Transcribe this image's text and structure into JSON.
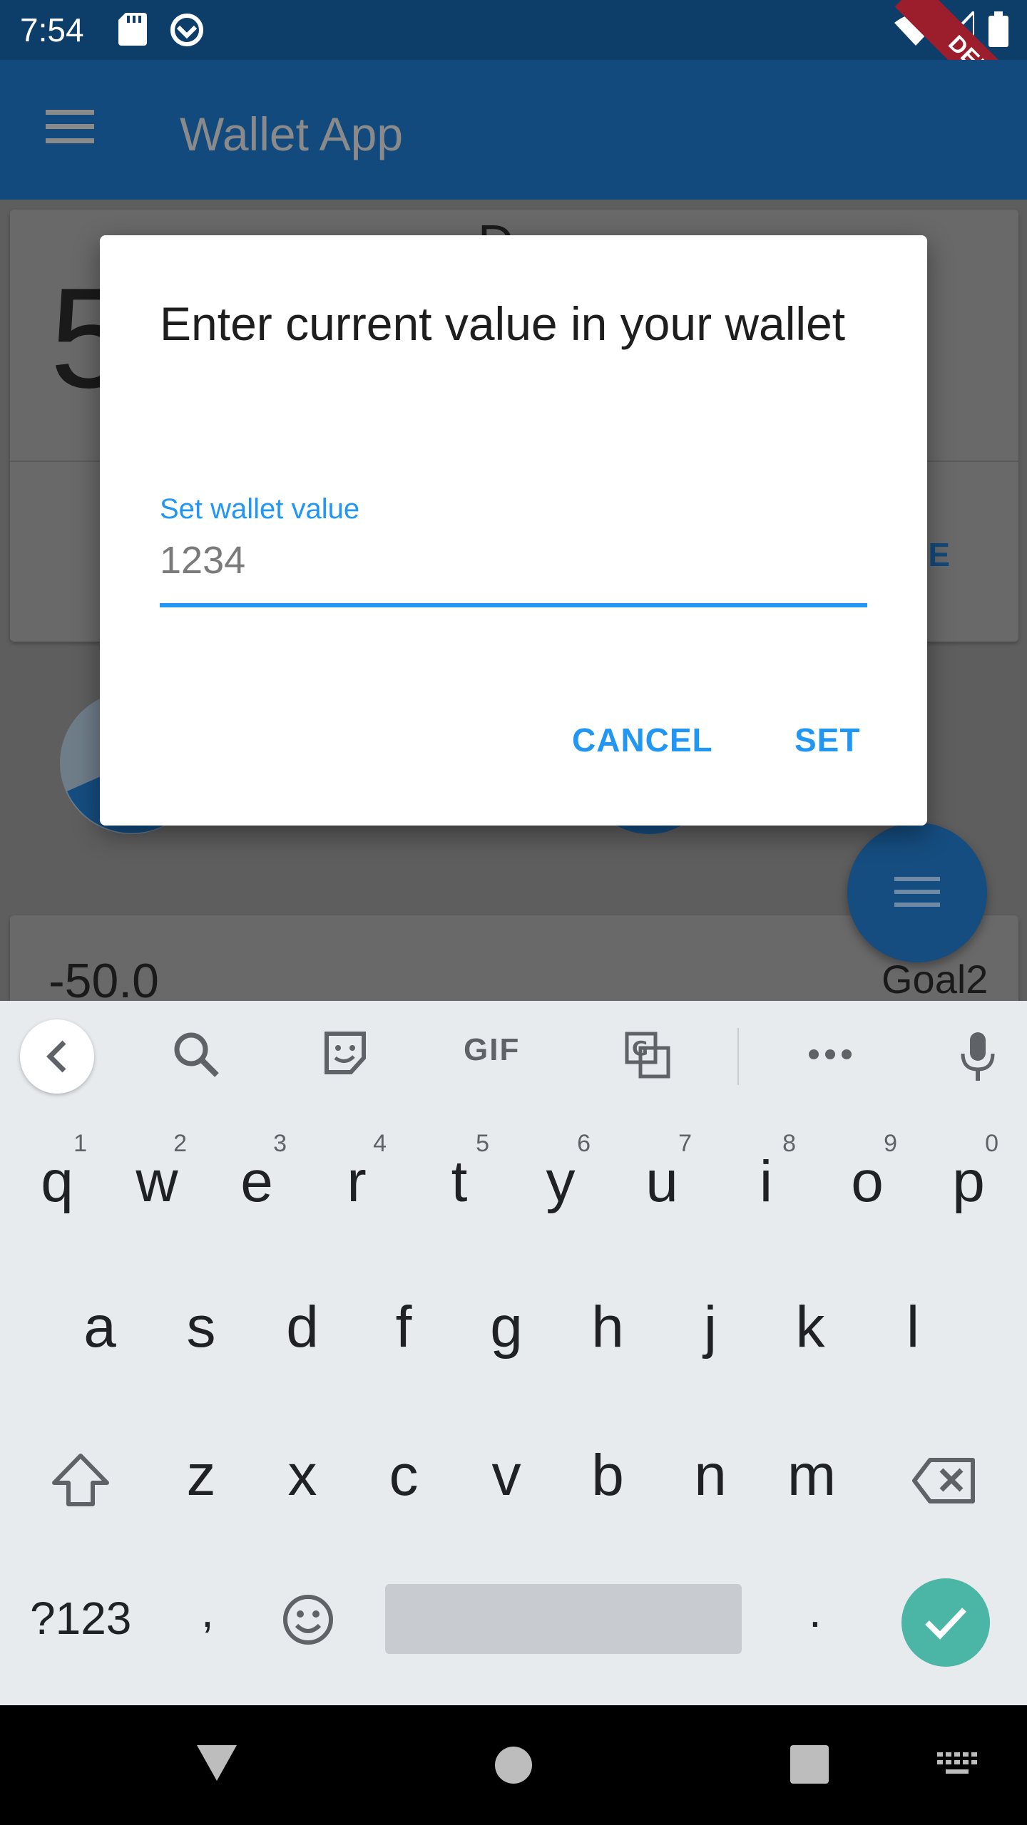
{
  "status_bar": {
    "time": "7:54",
    "debug_label": "DEBUG",
    "icons": [
      "sd-card-icon",
      "sync-icon",
      "wifi-icon",
      "signal-icon",
      "battery-icon"
    ]
  },
  "app_bar": {
    "title": "Wallet App",
    "menu_icon": "menu-icon"
  },
  "background": {
    "balance_digit": "5",
    "description_fragment": "D",
    "value_button_fragment": "LUE",
    "expense_value": "-50.0",
    "goal_label": "Goal2"
  },
  "dialog": {
    "title": "Enter current value in your wallet",
    "field_label": "Set wallet value",
    "field_value": "1234",
    "cancel_label": "CANCEL",
    "set_label": "SET",
    "accent_color": "#2196f3"
  },
  "keyboard": {
    "toolbar_icons": [
      "back-icon",
      "search-icon",
      "sticker-icon",
      "gif-icon",
      "translate-icon",
      "more-icon",
      "mic-icon"
    ],
    "gif_label": "GIF",
    "row1": [
      {
        "ch": "q",
        "hint": "1"
      },
      {
        "ch": "w",
        "hint": "2"
      },
      {
        "ch": "e",
        "hint": "3"
      },
      {
        "ch": "r",
        "hint": "4"
      },
      {
        "ch": "t",
        "hint": "5"
      },
      {
        "ch": "y",
        "hint": "6"
      },
      {
        "ch": "u",
        "hint": "7"
      },
      {
        "ch": "i",
        "hint": "8"
      },
      {
        "ch": "o",
        "hint": "9"
      },
      {
        "ch": "p",
        "hint": "0"
      }
    ],
    "row2": [
      "a",
      "s",
      "d",
      "f",
      "g",
      "h",
      "j",
      "k",
      "l"
    ],
    "row3": [
      "z",
      "x",
      "c",
      "v",
      "b",
      "n",
      "m"
    ],
    "symbols_label": "?123",
    "comma_label": ",",
    "period_label": ".",
    "enter_color": "#4cb6a6"
  },
  "nav_bar": {
    "icons": [
      "back-triangle-icon",
      "home-circle-icon",
      "recents-square-icon",
      "keyboard-switch-icon"
    ]
  }
}
